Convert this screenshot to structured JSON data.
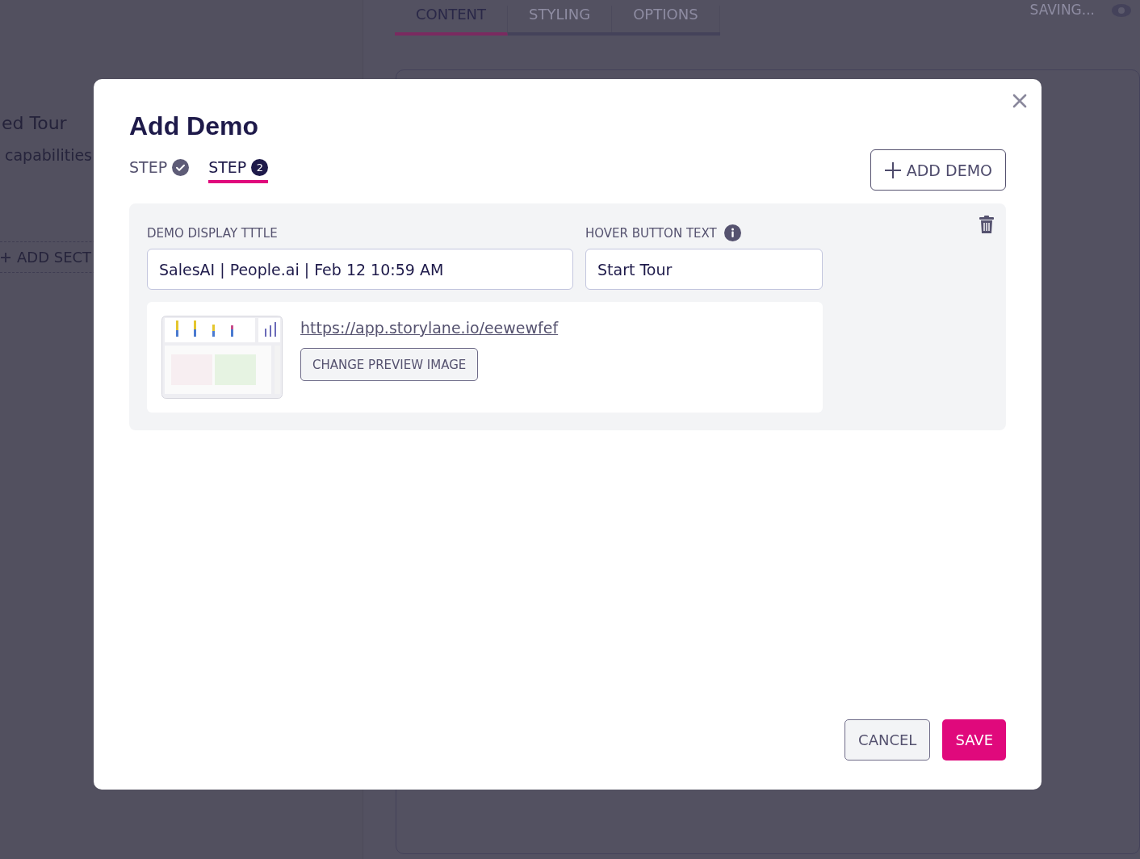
{
  "background": {
    "tabs": [
      {
        "label": "CONTENT",
        "selected": true
      },
      {
        "label": "STYLING",
        "selected": false
      },
      {
        "label": "OPTIONS",
        "selected": false
      }
    ],
    "status": "SAVING...",
    "sidebar": {
      "title": "ed Tour",
      "subtitle": "capabilities",
      "add_button": "ADD SECT"
    }
  },
  "dialog": {
    "title": "Add Demo",
    "steps": [
      {
        "label": "STEP",
        "kind": "done",
        "selected": false
      },
      {
        "label": "STEP",
        "kind": "number",
        "badge": "2",
        "selected": true
      }
    ],
    "add_button": "ADD DEMO",
    "demo": {
      "title_label": "DEMO DISPLAY TTTLE",
      "title_value": "SalesAI | People.ai | Feb 12 10:59 AM",
      "hover_label": "HOVER BUTTON TEXT",
      "hover_value": "Start Tour",
      "url": "https://app.storylane.io/eewewfef",
      "change_button": "CHANGE PREVIEW IMAGE"
    },
    "buttons": [
      {
        "label": "CANCEL",
        "kind": "secondary"
      },
      {
        "label": "SAVE",
        "kind": "primary"
      }
    ]
  }
}
